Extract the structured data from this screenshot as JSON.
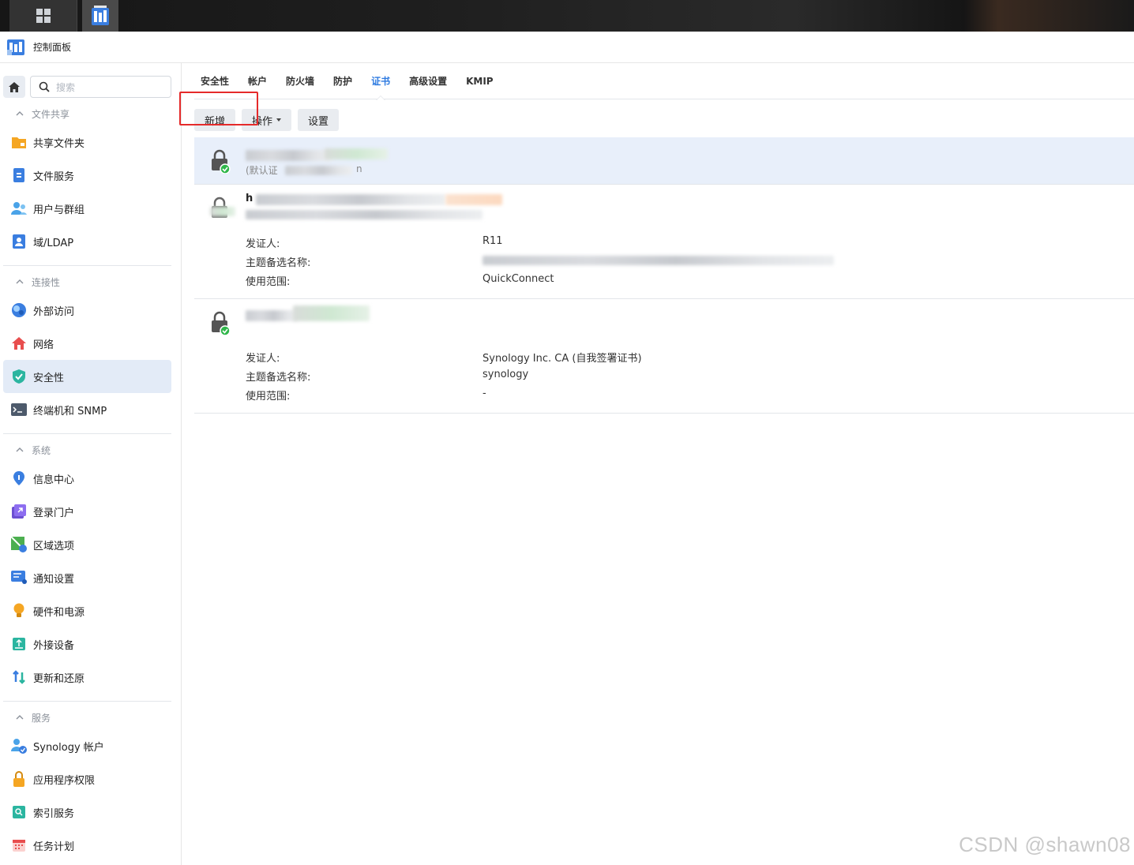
{
  "window": {
    "title": "控制面板"
  },
  "search": {
    "placeholder": "搜索"
  },
  "sidebar": {
    "groups": [
      {
        "label": "文件共享",
        "items": [
          {
            "label": "共享文件夹",
            "icon": "folder-share-icon"
          },
          {
            "label": "文件服务",
            "icon": "file-services-icon"
          },
          {
            "label": "用户与群组",
            "icon": "users-groups-icon"
          },
          {
            "label": "域/LDAP",
            "icon": "ldap-icon"
          }
        ]
      },
      {
        "label": "连接性",
        "items": [
          {
            "label": "外部访问",
            "icon": "external-access-icon"
          },
          {
            "label": "网络",
            "icon": "network-icon"
          },
          {
            "label": "安全性",
            "icon": "security-shield-icon",
            "active": true
          },
          {
            "label": "终端机和 SNMP",
            "icon": "terminal-icon"
          }
        ]
      },
      {
        "label": "系统",
        "items": [
          {
            "label": "信息中心",
            "icon": "info-center-icon"
          },
          {
            "label": "登录门户",
            "icon": "login-portal-icon"
          },
          {
            "label": "区域选项",
            "icon": "regional-options-icon"
          },
          {
            "label": "通知设置",
            "icon": "notification-icon"
          },
          {
            "label": "硬件和电源",
            "icon": "hardware-power-icon"
          },
          {
            "label": "外接设备",
            "icon": "external-devices-icon"
          },
          {
            "label": "更新和还原",
            "icon": "update-restore-icon"
          }
        ]
      },
      {
        "label": "服务",
        "items": [
          {
            "label": "Synology 帐户",
            "icon": "synology-account-icon"
          },
          {
            "label": "应用程序权限",
            "icon": "app-privileges-icon"
          },
          {
            "label": "索引服务",
            "icon": "indexing-service-icon"
          },
          {
            "label": "任务计划",
            "icon": "task-scheduler-icon"
          }
        ]
      }
    ]
  },
  "tabs": [
    {
      "label": "安全性"
    },
    {
      "label": "帐户"
    },
    {
      "label": "防火墙"
    },
    {
      "label": "防护"
    },
    {
      "label": "证书",
      "active": true
    },
    {
      "label": "高级设置"
    },
    {
      "label": "KMIP"
    }
  ],
  "toolbar": {
    "add_label": "新增",
    "action_label": "操作",
    "settings_label": "设置"
  },
  "certificates": [
    {
      "name": "",
      "subtitle": "(默认证",
      "subtitle_tail": "n",
      "selected": true
    },
    {
      "name": "h",
      "issuer_label": "发证人:",
      "issuer": "R11",
      "san_label": "主题备选名称:",
      "san": "",
      "scope_label": "使用范围:",
      "scope": "QuickConnect"
    },
    {
      "name": "",
      "issuer_label": "发证人:",
      "issuer": "Synology Inc. CA (自我签署证书)",
      "san_label": "主题备选名称:",
      "san": "synology",
      "scope_label": "使用范围:",
      "scope": "-"
    }
  ],
  "watermark": "CSDN @shawn08",
  "colors": {
    "accent": "#2d7ae0",
    "highlight_box": "#e52a2a",
    "selected_row": "#e8effa",
    "status_ok": "#2fb64a"
  }
}
